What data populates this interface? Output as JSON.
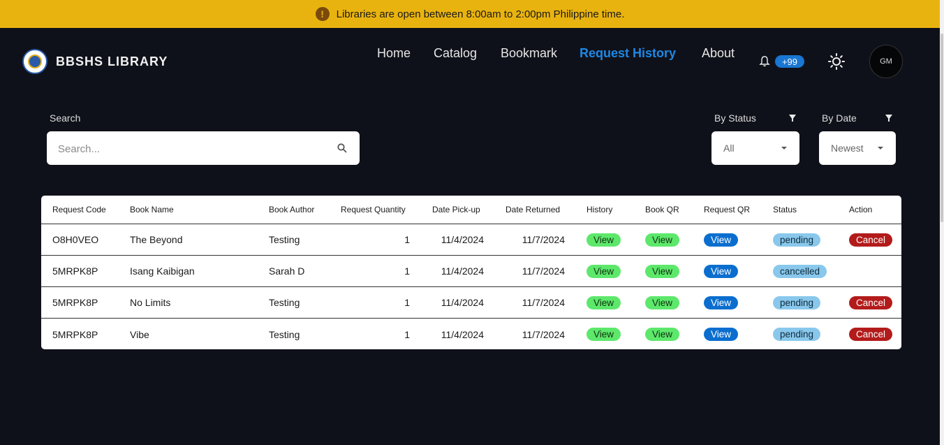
{
  "banner": {
    "text": "Libraries are open between 8:00am to 2:00pm Philippine time."
  },
  "brand": {
    "name": "BBSHS LIBRARY"
  },
  "nav": {
    "home": "Home",
    "catalog": "Catalog",
    "bookmark": "Bookmark",
    "request_history": "Request History",
    "about": "About",
    "notification_count": "+99",
    "avatar_initials": "GM"
  },
  "search": {
    "label": "Search",
    "placeholder": "Search..."
  },
  "filters": {
    "status": {
      "label": "By Status",
      "value": "All"
    },
    "date": {
      "label": "By Date",
      "value": "Newest"
    }
  },
  "table": {
    "headers": [
      "Request Code",
      "Book Name",
      "Book Author",
      "Request Quantity",
      "Date Pick-up",
      "Date Returned",
      "History",
      "Book QR",
      "Request QR",
      "Status",
      "Action"
    ],
    "rows": [
      {
        "code": "O8H0VEO",
        "book": "The Beyond",
        "author": "Testing",
        "qty": "1",
        "pickup": "11/4/2024",
        "returned": "11/7/2024",
        "history": "View",
        "book_qr": "View",
        "request_qr": "View",
        "status": "pending",
        "action": "Cancel"
      },
      {
        "code": "5MRPK8P",
        "book": "Isang Kaibigan",
        "author": "Sarah D",
        "qty": "1",
        "pickup": "11/4/2024",
        "returned": "11/7/2024",
        "history": "View",
        "book_qr": "View",
        "request_qr": "View",
        "status": "cancelled",
        "action": ""
      },
      {
        "code": "5MRPK8P",
        "book": "No Limits",
        "author": "Testing",
        "qty": "1",
        "pickup": "11/4/2024",
        "returned": "11/7/2024",
        "history": "View",
        "book_qr": "View",
        "request_qr": "View",
        "status": "pending",
        "action": "Cancel"
      },
      {
        "code": "5MRPK8P",
        "book": "Vibe",
        "author": "Testing",
        "qty": "1",
        "pickup": "11/4/2024",
        "returned": "11/7/2024",
        "history": "View",
        "book_qr": "View",
        "request_qr": "View",
        "status": "pending",
        "action": "Cancel"
      }
    ]
  },
  "colors": {
    "banner": "#e9b30f",
    "background": "#0f111a",
    "accent": "#1e88e5",
    "view_green": "#5de86b",
    "view_blue": "#0b6ecf",
    "status": "#89c8ec",
    "cancel": "#b31b1b"
  }
}
